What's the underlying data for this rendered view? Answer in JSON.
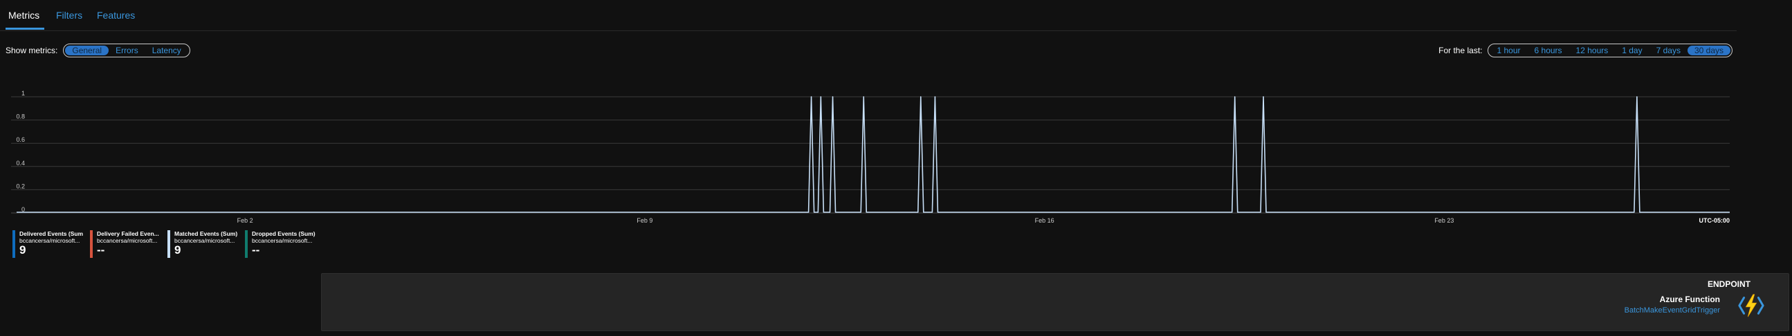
{
  "tabs": [
    {
      "label": "Metrics",
      "active": true
    },
    {
      "label": "Filters",
      "active": false
    },
    {
      "label": "Features",
      "active": false
    }
  ],
  "show_metrics": {
    "label": "Show metrics:",
    "options": [
      "General",
      "Errors",
      "Latency"
    ],
    "selected": "General"
  },
  "for_the_last": {
    "label": "For the last:",
    "options": [
      "1 hour",
      "6 hours",
      "12 hours",
      "1 day",
      "7 days",
      "30 days"
    ],
    "selected": "30 days"
  },
  "chart_data": {
    "type": "line",
    "x_range": [
      "2021-01-29",
      "2021-02-28"
    ],
    "ylim": [
      0,
      1
    ],
    "y_ticks": [
      "0",
      "0.2",
      "0.4",
      "0.6",
      "0.8",
      "1"
    ],
    "x_ticks": [
      {
        "label": "Feb 2",
        "date": "2021-02-02"
      },
      {
        "label": "Feb 9",
        "date": "2021-02-09"
      },
      {
        "label": "Feb 16",
        "date": "2021-02-16"
      },
      {
        "label": "Feb 23",
        "date": "2021-02-23"
      }
    ],
    "timezone_label": "UTC-05:00",
    "grid": true,
    "series": [
      {
        "name": "Matched Events (Sum)",
        "color": "#c7dff7",
        "spikes": [
          {
            "date": "2021-02-11T22:00",
            "value": 1
          },
          {
            "date": "2021-02-12T02:00",
            "value": 1
          },
          {
            "date": "2021-02-12T07:00",
            "value": 1
          },
          {
            "date": "2021-02-12T20:00",
            "value": 1
          },
          {
            "date": "2021-02-13T20:00",
            "value": 1
          },
          {
            "date": "2021-02-14T02:00",
            "value": 1
          },
          {
            "date": "2021-02-19T08:00",
            "value": 1
          },
          {
            "date": "2021-02-19T20:00",
            "value": 1
          },
          {
            "date": "2021-02-26T09:00",
            "value": 1
          }
        ]
      }
    ]
  },
  "legend": [
    {
      "title": "Delivered Events (Sum)",
      "subtitle": "bccancersa/microsoft...",
      "value": "9",
      "color": "#0f6cbd"
    },
    {
      "title": "Delivery Failed Even...",
      "subtitle": "bccancersa/microsoft...",
      "value": "--",
      "color": "#d6533e"
    },
    {
      "title": "Matched Events (Sum)",
      "subtitle": "bccancersa/microsoft...",
      "value": "9",
      "color": "#c7dff7"
    },
    {
      "title": "Dropped Events (Sum)",
      "subtitle": "bccancersa/microsoft...",
      "value": "--",
      "color": "#107c6e"
    }
  ],
  "endpoint": {
    "header": "ENDPOINT",
    "type": "Azure Function",
    "name": "BatchMakeEventGridTrigger",
    "icon": "azure-function-bolt-icon"
  }
}
